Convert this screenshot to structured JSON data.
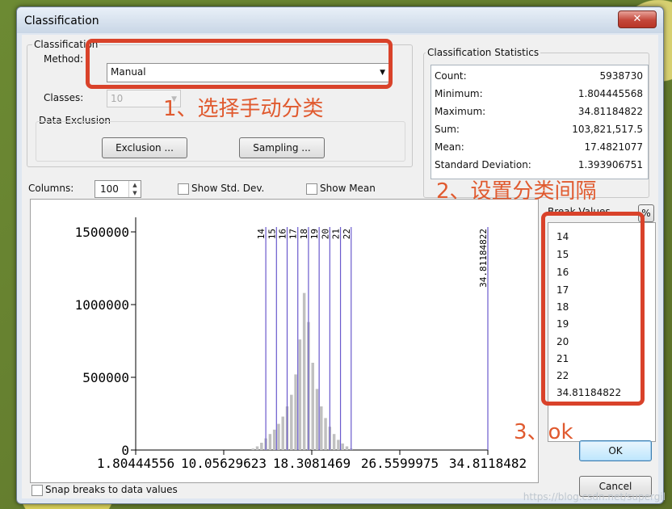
{
  "window": {
    "title": "Classification",
    "close_label": "✕"
  },
  "classification": {
    "group_label": "Classification",
    "method_label": "Method:",
    "method_value": "Manual",
    "classes_label": "Classes:",
    "classes_value": "10",
    "data_exclusion_label": "Data Exclusion",
    "exclusion_button": "Exclusion ...",
    "sampling_button": "Sampling ..."
  },
  "statistics": {
    "group_label": "Classification Statistics",
    "rows": [
      {
        "key": "Count:",
        "value": "5938730"
      },
      {
        "key": "Minimum:",
        "value": "1.804445568"
      },
      {
        "key": "Maximum:",
        "value": "34.81184822"
      },
      {
        "key": "Sum:",
        "value": "103,821,517.5"
      },
      {
        "key": "Mean:",
        "value": "17.4821077"
      },
      {
        "key": "Standard Deviation:",
        "value": "1.393906751"
      }
    ]
  },
  "columns": {
    "label": "Columns:",
    "value": "100"
  },
  "show_std_dev": {
    "label": "Show Std. Dev.",
    "checked": false
  },
  "show_mean": {
    "label": "Show Mean",
    "checked": false
  },
  "break_values": {
    "header": "Break Values",
    "percent_button": "%",
    "items": [
      "14",
      "15",
      "16",
      "17",
      "18",
      "19",
      "20",
      "21",
      "22",
      "34.81184822"
    ]
  },
  "buttons": {
    "ok": "OK",
    "cancel": "Cancel"
  },
  "snap": {
    "label": "Snap breaks to data values",
    "checked": false
  },
  "annotations": {
    "a1": "1、选择手动分类",
    "a2": "2、设置分类间隔",
    "a3": "3、ok"
  },
  "watermark": "https://blog.csdn.net/supergil",
  "chart_data": {
    "type": "bar",
    "y_ticks": [
      "1500000",
      "1000000",
      "500000",
      "0"
    ],
    "x_tick_labels": [
      "1.80444556",
      "10.05629623",
      "18.3081469",
      "26.5599975",
      "34.8118482"
    ],
    "ylim": [
      0,
      1600000
    ],
    "xlim": [
      1.804445568,
      34.81184822
    ],
    "break_lines": [
      14,
      15,
      16,
      17,
      18,
      19,
      20,
      21,
      22,
      34.81184822
    ],
    "break_line_labels": [
      "14",
      "15",
      "16",
      "17",
      "18",
      "19",
      "20",
      "21",
      "22",
      "34.81184822"
    ],
    "bins": [
      {
        "x": 12.8,
        "value": 10000
      },
      {
        "x": 13.2,
        "value": 25000
      },
      {
        "x": 13.6,
        "value": 50000
      },
      {
        "x": 14.0,
        "value": 80000
      },
      {
        "x": 14.4,
        "value": 110000
      },
      {
        "x": 14.8,
        "value": 140000
      },
      {
        "x": 15.2,
        "value": 180000
      },
      {
        "x": 15.6,
        "value": 230000
      },
      {
        "x": 16.0,
        "value": 300000
      },
      {
        "x": 16.4,
        "value": 380000
      },
      {
        "x": 16.8,
        "value": 520000
      },
      {
        "x": 17.2,
        "value": 760000
      },
      {
        "x": 17.6,
        "value": 1080000
      },
      {
        "x": 18.0,
        "value": 880000
      },
      {
        "x": 18.4,
        "value": 600000
      },
      {
        "x": 18.8,
        "value": 420000
      },
      {
        "x": 19.2,
        "value": 300000
      },
      {
        "x": 19.6,
        "value": 220000
      },
      {
        "x": 20.0,
        "value": 160000
      },
      {
        "x": 20.4,
        "value": 110000
      },
      {
        "x": 20.8,
        "value": 70000
      },
      {
        "x": 21.2,
        "value": 45000
      },
      {
        "x": 21.6,
        "value": 25000
      },
      {
        "x": 22.0,
        "value": 10000
      }
    ],
    "colors": {
      "bars": "#c0c0c0",
      "break_lines": "#6a5acd"
    }
  }
}
